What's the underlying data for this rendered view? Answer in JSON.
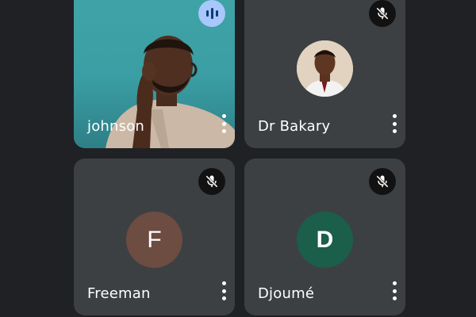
{
  "participants": [
    {
      "name": "johnson",
      "status": "speaking",
      "has_video": true,
      "icons": {
        "status": "audio-waveform-icon",
        "more": "more-vert-icon"
      }
    },
    {
      "name": "Dr Bakary",
      "status": "muted",
      "has_video": false,
      "avatar": "photo",
      "icons": {
        "status": "mic-off-icon",
        "more": "more-vert-icon"
      }
    },
    {
      "name": "Freeman",
      "status": "muted",
      "has_video": false,
      "avatar_letter": "F",
      "avatar_color": "#6d4c41",
      "icons": {
        "status": "mic-off-icon",
        "more": "more-vert-icon"
      }
    },
    {
      "name": "Djoumé",
      "status": "muted",
      "has_video": false,
      "avatar_letter": "D",
      "avatar_color": "#1b5e4a",
      "icons": {
        "status": "mic-off-icon",
        "more": "more-vert-icon"
      }
    }
  ],
  "colors": {
    "background": "#202124",
    "tile": "#3c4043",
    "speaking_badge": "#a8c7fa",
    "mute_badge": "#121212"
  }
}
